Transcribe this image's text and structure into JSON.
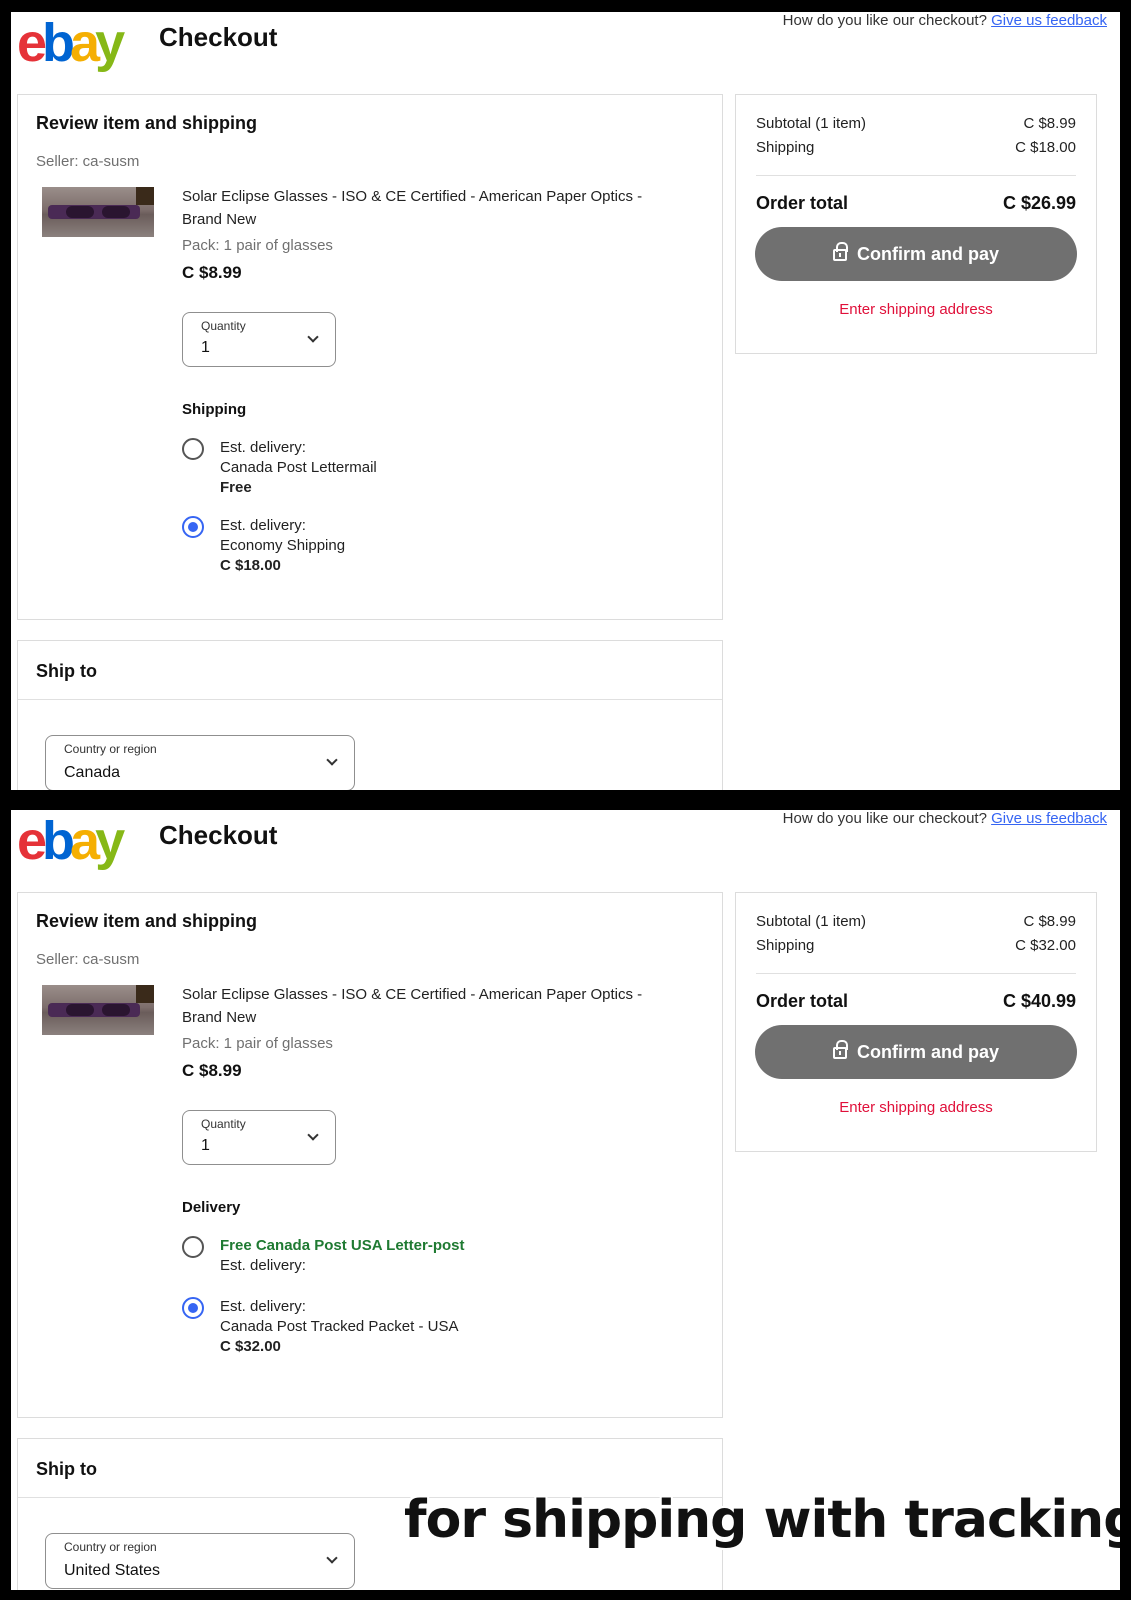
{
  "screens": [
    {
      "header": {
        "logo": {
          "e": "e",
          "b": "b",
          "a": "a",
          "y": "y"
        },
        "title": "Checkout",
        "feedback_prompt": "How do you like our checkout?",
        "feedback_link": "Give us feedback"
      },
      "review": {
        "title": "Review item and shipping",
        "seller": "Seller:  ca-susm",
        "item_title": "Solar Eclipse Glasses - ISO & CE Certified - American Paper Optics - Brand New",
        "pack": "Pack: 1 pair of glasses",
        "price": "C $8.99",
        "quantity_label": "Quantity",
        "quantity_value": "1",
        "shipping_heading": "Shipping",
        "options": [
          {
            "checked": false,
            "line1": "Est. delivery:",
            "line2": "Canada Post Lettermail",
            "line3": "Free"
          },
          {
            "checked": true,
            "line1": "Est. delivery:",
            "line2": "Economy Shipping",
            "line3": "C $18.00"
          }
        ]
      },
      "summary": {
        "subtotal_label": "Subtotal (1 item)",
        "subtotal_value": "C $8.99",
        "shipping_label": "Shipping",
        "shipping_value": "C $18.00",
        "total_label": "Order total",
        "total_value": "C $26.99",
        "pay_button": "Confirm and pay",
        "warning": "Enter shipping address"
      },
      "ship_to": {
        "title": "Ship to",
        "country_label": "Country or region",
        "country_value": "Canada"
      }
    },
    {
      "header": {
        "logo": {
          "e": "e",
          "b": "b",
          "a": "a",
          "y": "y"
        },
        "title": "Checkout",
        "feedback_prompt": "How do you like our checkout?",
        "feedback_link": "Give us feedback"
      },
      "review": {
        "title": "Review item and shipping",
        "seller": "Seller:  ca-susm",
        "item_title": "Solar Eclipse Glasses - ISO & CE Certified - American Paper Optics - Brand New",
        "pack": "Pack: 1 pair of glasses",
        "price": "C $8.99",
        "quantity_label": "Quantity",
        "quantity_value": "1",
        "shipping_heading": "Delivery",
        "options": [
          {
            "checked": false,
            "line1": "Free Canada Post USA Letter-post",
            "line2": "Est. delivery:",
            "line3": ""
          },
          {
            "checked": true,
            "line1": "Est. delivery:",
            "line2": "Canada Post Tracked Packet - USA",
            "line3": "C $32.00"
          }
        ]
      },
      "summary": {
        "subtotal_label": "Subtotal (1 item)",
        "subtotal_value": "C $8.99",
        "shipping_label": "Shipping",
        "shipping_value": "C $32.00",
        "total_label": "Order total",
        "total_value": "C $40.99",
        "pay_button": "Confirm and pay",
        "warning": "Enter shipping address"
      },
      "ship_to": {
        "title": "Ship to",
        "country_label": "Country or region",
        "country_value": "United States"
      }
    }
  ],
  "caption": "for shipping with tracking"
}
